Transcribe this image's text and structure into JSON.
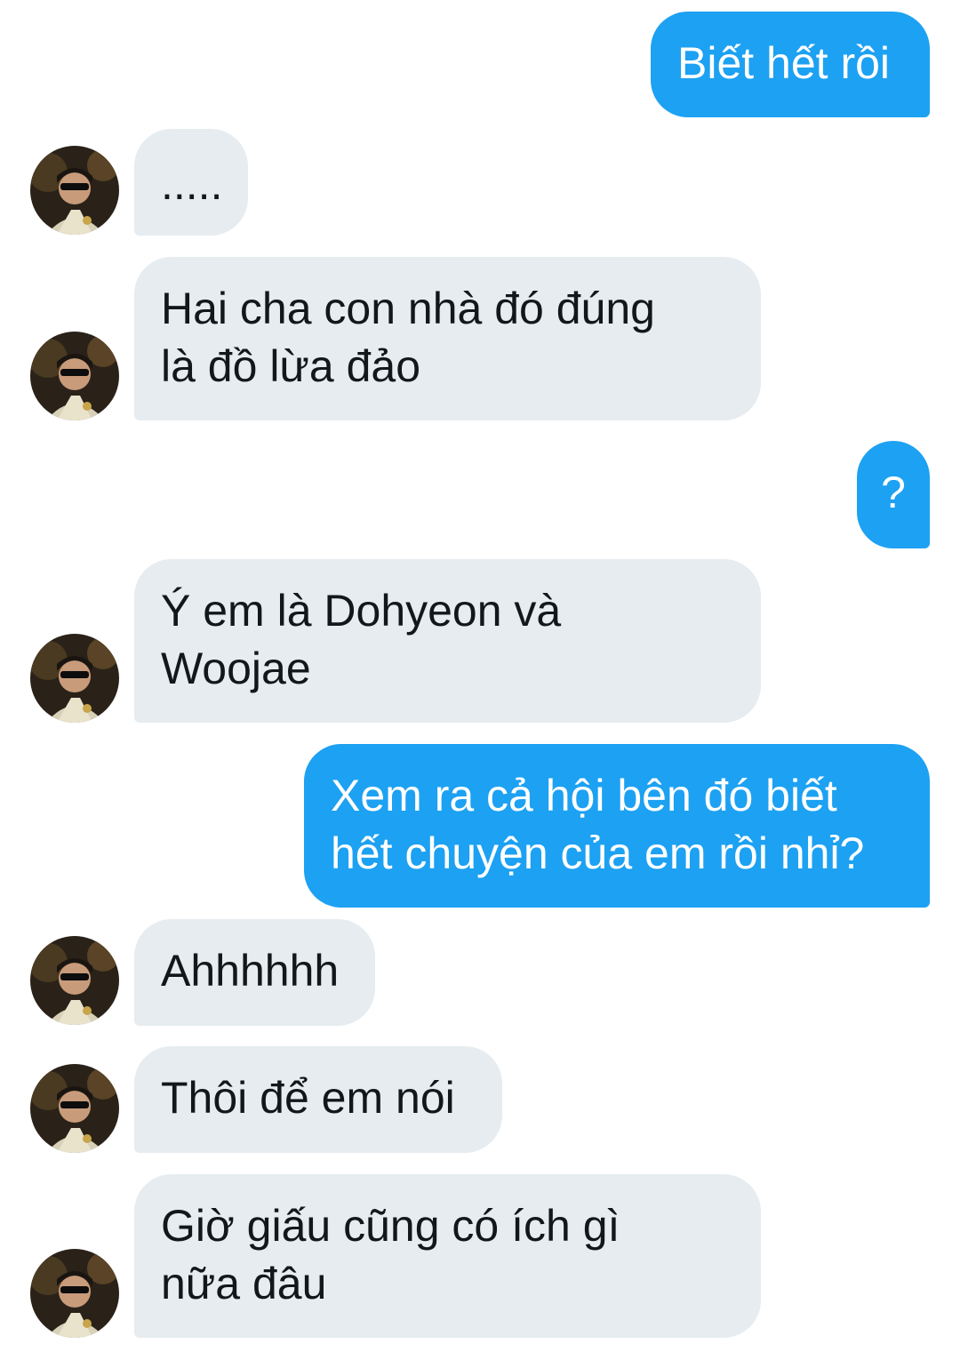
{
  "conversation": {
    "messages": [
      {
        "from": "me",
        "text": "Biết hết rồi"
      },
      {
        "from": "them",
        "text": "....."
      },
      {
        "from": "them",
        "text": "Hai cha con nhà đó đúng\nlà đồ lừa đảo"
      },
      {
        "from": "me",
        "text": "?"
      },
      {
        "from": "them",
        "text": "Ý em là Dohyeon và\nWoojae"
      },
      {
        "from": "me",
        "text": "Xem ra cả hội bên đó biết\nhết chuyện của em rồi nhỉ?"
      },
      {
        "from": "them",
        "text": "Ahhhhhh"
      },
      {
        "from": "them",
        "text": "Thôi để em nói"
      },
      {
        "from": "them",
        "text": "Giờ giấu cũng có ích gì\nnữa đâu"
      }
    ]
  },
  "colors": {
    "sent_bubble": "#1da1f2",
    "received_bubble": "#e6ecf0",
    "sent_text": "#ffffff",
    "received_text": "#14171a"
  },
  "icons": {
    "avatar": "user-avatar-photo"
  }
}
